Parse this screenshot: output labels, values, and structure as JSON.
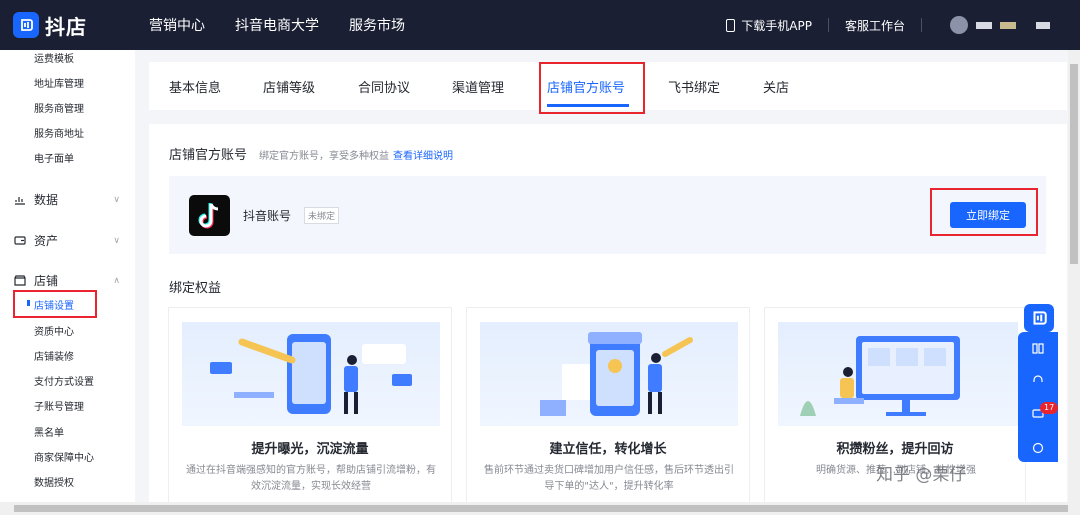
{
  "brand": {
    "name": "抖店"
  },
  "topnav": [
    "营销中心",
    "抖音电商大学",
    "服务市场"
  ],
  "top_right": {
    "download_app": "下载手机APP",
    "service_desk": "客服工作台"
  },
  "sidebar": {
    "sub_top": [
      "运费模板",
      "地址库管理",
      "服务商管理",
      "服务商地址",
      "电子面单"
    ],
    "groups": {
      "data": "数据",
      "assets": "资产",
      "shop": "店铺"
    },
    "shop_items": [
      "店铺设置",
      "资质中心",
      "店铺装修",
      "支付方式设置",
      "子账号管理",
      "黑名单",
      "商家保障中心",
      "数据授权"
    ]
  },
  "tabs": [
    "基本信息",
    "店铺等级",
    "合同协议",
    "渠道管理",
    "店铺官方账号",
    "飞书绑定",
    "关店"
  ],
  "official": {
    "title": "店铺官方账号",
    "desc": "绑定官方账号，享受多种权益",
    "link": "查看详细说明",
    "account_name": "抖音账号",
    "status": "未绑定",
    "bind_button": "立即绑定"
  },
  "benefits": {
    "title": "绑定权益",
    "cards": [
      {
        "title": "提升曝光，沉淀流量",
        "desc": "通过在抖音端强感知的官方账号，帮助店铺引流增粉，有效沉淀流量，实现长效经营"
      },
      {
        "title": "建立信任，转化增长",
        "desc": "售前环节通过卖货口碑增加用户信任感，售后环节透出引导下单的\"达人\"，提升转化率"
      },
      {
        "title": "积攒粉丝，提升回访",
        "desc": "明确货源、推荐…到店铺，粘性增强"
      }
    ]
  },
  "float_badge": "17",
  "watermark": "知乎 @栗仔",
  "colors": {
    "accent": "#1966ff",
    "topbar": "#1a1f33",
    "highlight": "#e8242e"
  }
}
